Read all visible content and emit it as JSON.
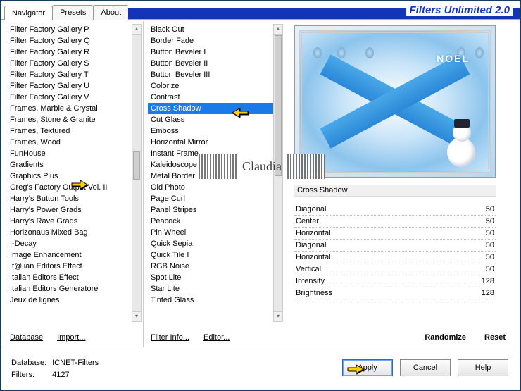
{
  "title": "Filters Unlimited 2.0",
  "tabs": [
    {
      "label": "Navigator",
      "active": true
    },
    {
      "label": "Presets",
      "active": false
    },
    {
      "label": "About",
      "active": false
    }
  ],
  "category_list": [
    "Filter Factory Gallery P",
    "Filter Factory Gallery Q",
    "Filter Factory Gallery R",
    "Filter Factory Gallery S",
    "Filter Factory Gallery T",
    "Filter Factory Gallery U",
    "Filter Factory Gallery V",
    "Frames, Marble & Crystal",
    "Frames, Stone & Granite",
    "Frames, Textured",
    "Frames, Wood",
    "FunHouse",
    "Gradients",
    "Graphics Plus",
    "Greg's Factory Output Vol. II",
    "Harry's Button Tools",
    "Harry's Power Grads",
    "Harry's Rave Grads",
    "Horizonaus Mixed Bag",
    "I-Decay",
    "Image Enhancement",
    "It@lian Editors Effect",
    "Italian Editors Effect",
    "Italian Editors Generatore",
    "Jeux de lignes"
  ],
  "category_pointer_index": 13,
  "filter_list": [
    "Black Out",
    "Border Fade",
    "Button Beveler I",
    "Button Beveler II",
    "Button Beveler III",
    "Colorize",
    "Contrast",
    "Cross Shadow",
    "Cut Glass",
    "Emboss",
    "Horizontal Mirror",
    "Instant Frame",
    "Kaleidoscope",
    "Metal Border",
    "Old Photo",
    "Page Curl",
    "Panel Stripes",
    "Peacock",
    "Pin Wheel",
    "Quick Sepia",
    "Quick Tile I",
    "RGB Noise",
    "Spot Lite",
    "Star Lite",
    "Tinted Glass"
  ],
  "filter_selected_index": 7,
  "left_links": {
    "database": "Database",
    "import": "Import..."
  },
  "mid_links": {
    "info": "Filter Info...",
    "editor": "Editor..."
  },
  "right_links": {
    "randomize": "Randomize",
    "reset": "Reset"
  },
  "selected_filter_name": "Cross Shadow",
  "preview_text": "NOEL",
  "watermark_text": "Claudia",
  "parameters": [
    {
      "name": "Diagonal",
      "value": 50
    },
    {
      "name": "Center",
      "value": 50
    },
    {
      "name": "Horizontal",
      "value": 50
    },
    {
      "name": "Diagonal",
      "value": 50
    },
    {
      "name": "Horizontal",
      "value": 50
    },
    {
      "name": "Vertical",
      "value": 50
    },
    {
      "name": "Intensity",
      "value": 128
    },
    {
      "name": "Brightness",
      "value": 128
    }
  ],
  "footer": {
    "db_label": "Database:",
    "db_value": "ICNET-Filters",
    "filters_label": "Filters:",
    "filters_value": "4127",
    "apply": "Apply",
    "cancel": "Cancel",
    "help": "Help"
  }
}
